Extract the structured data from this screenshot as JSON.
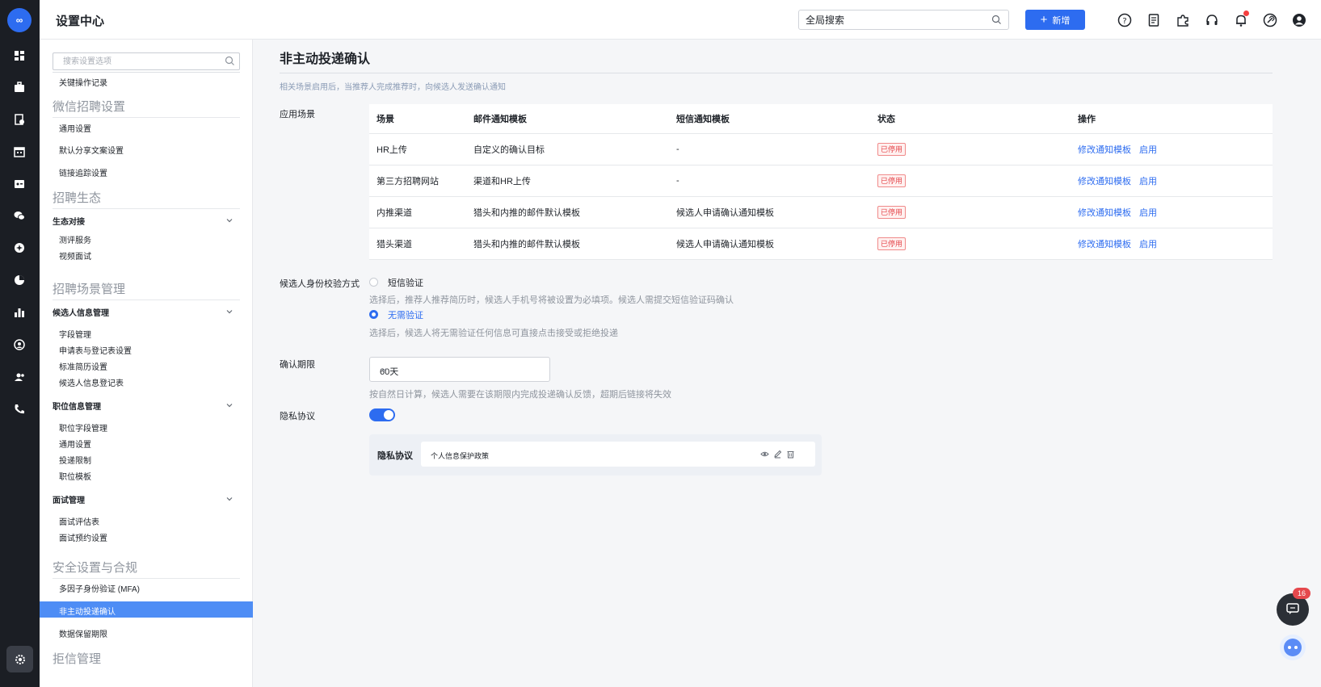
{
  "app": {
    "logo_text": "∞",
    "title": "设置中心",
    "search_placeholder": "全局搜索",
    "new_button": "新增",
    "accent": "#2d6cf0",
    "notification_count": "16"
  },
  "rail_icons": [
    "dashboard-icon",
    "briefcase-icon",
    "resume-icon",
    "calendar-icon",
    "id-card-icon",
    "wechat-icon",
    "ai-icon",
    "pie-chart-icon",
    "bar-chart-icon",
    "user-circle-icon",
    "team-icon",
    "phone-icon",
    "settings-icon"
  ],
  "topbar_icons": [
    "help-icon",
    "document-icon",
    "plugin-icon",
    "headset-icon",
    "bell-icon",
    "link-icon",
    "user-icon"
  ],
  "sidebar": {
    "search_placeholder": "搜索设置选项",
    "key_ops": "关键操作记录",
    "wechat": {
      "title": "微信招聘设置",
      "items": [
        "通用设置",
        "默认分享文案设置",
        "链接追踪设置"
      ]
    },
    "eco": {
      "title": "招聘生态",
      "group": "生态对接",
      "items": [
        "测评服务",
        "视频面试"
      ]
    },
    "scene": {
      "title": "招聘场景管理",
      "groups": [
        {
          "name": "候选人信息管理",
          "items": [
            "字段管理",
            "申请表与登记表设置",
            "标准简历设置",
            "候选人信息登记表"
          ]
        },
        {
          "name": "职位信息管理",
          "items": [
            "职位字段管理",
            "通用设置",
            "投递限制",
            "职位模板"
          ]
        },
        {
          "name": "面试管理",
          "items": [
            "面试评估表",
            "面试预约设置"
          ]
        }
      ]
    },
    "security": {
      "title": "安全设置与合规",
      "items": [
        "多因子身份验证 (MFA)",
        "非主动投递确认",
        "数据保留期限"
      ]
    },
    "reject": {
      "title": "拒信管理"
    }
  },
  "main": {
    "title": "非主动投递确认",
    "description": "相关场景启用后，当推荐人完成推荐时，向候选人发送确认通知",
    "scenes_label": "应用场景",
    "table": {
      "headers": [
        "场景",
        "邮件通知模板",
        "短信通知模板",
        "状态",
        "操作"
      ],
      "rows": [
        {
          "scene": "HR上传",
          "email": "自定义的确认目标",
          "sms": "-",
          "status": "已停用",
          "edit": "修改通知模板",
          "enable": "启用"
        },
        {
          "scene": "第三方招聘网站",
          "email": "渠道和HR上传",
          "sms": "-",
          "status": "已停用",
          "edit": "修改通知模板",
          "enable": "启用"
        },
        {
          "scene": "内推渠道",
          "email": "猎头和内推的邮件默认模板",
          "sms": "候选人申请确认通知模板",
          "status": "已停用",
          "edit": "修改通知模板",
          "enable": "启用"
        },
        {
          "scene": "猎头渠道",
          "email": "猎头和内推的邮件默认模板",
          "sms": "候选人申请确认通知模板",
          "status": "已停用",
          "edit": "修改通知模板",
          "enable": "启用"
        }
      ]
    },
    "verify": {
      "label": "候选人身份校验方式",
      "option1": "短信验证",
      "option1_hint": "选择后，推荐人推荐简历时，候选人手机号将被设置为必填项。候选人需提交短信验证码确认",
      "option2": "无需验证",
      "option2_hint": "选择后，候选人将无需验证任何信息可直接点击接受或拒绝投递",
      "selected": "无需验证"
    },
    "period": {
      "label": "确认期限",
      "value": "60天",
      "hint": "按自然日计算，候选人需要在该期限内完成投递确认反馈，超期后链接将失效"
    },
    "privacy": {
      "label": "隐私协议",
      "enabled": true,
      "box_label": "隐私协议",
      "policy_name": "个人信息保护政策"
    }
  }
}
